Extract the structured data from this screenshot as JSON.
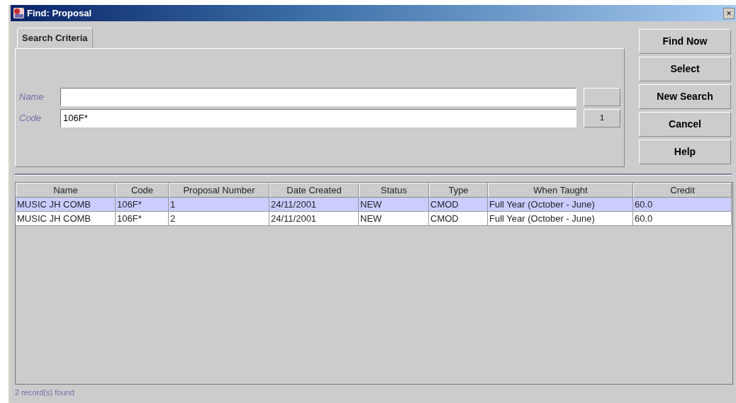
{
  "window": {
    "title": "Find: Proposal",
    "close": "×"
  },
  "tabs": [
    {
      "label": "Search Criteria",
      "selected": true
    }
  ],
  "fields": [
    {
      "label": "Name"
    },
    {
      "label": "Code",
      "value": "106F*",
      "button": "1"
    }
  ],
  "buttons": [
    "Find Now",
    "Select",
    "New Search",
    "Cancel",
    "Help"
  ],
  "table": {
    "columns": [
      "Name",
      "Code",
      "Proposal Number",
      "Date Created",
      "Status",
      "Type",
      "When Taught",
      "Credit"
    ],
    "rows": [
      {
        "selected": true,
        "cells": [
          "MUSIC JH COMB",
          "106F*",
          "1",
          "24/11/2001",
          "NEW",
          "CMOD",
          "Full Year (October - June)",
          "60.0"
        ]
      },
      {
        "selected": false,
        "cells": [
          "MUSIC JH COMB",
          "106F*",
          "2",
          "24/11/2001",
          "NEW",
          "CMOD",
          "Full Year (October - June)",
          "60.0"
        ]
      }
    ]
  },
  "status_bar": "2 record(s) found"
}
